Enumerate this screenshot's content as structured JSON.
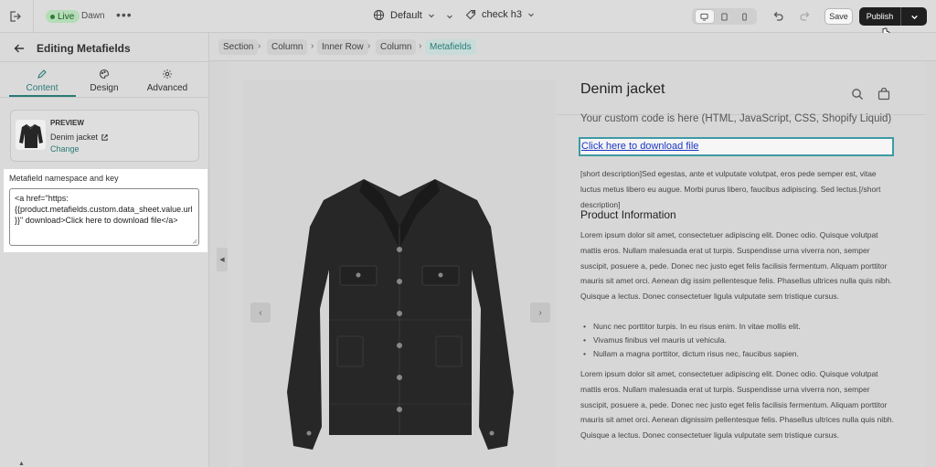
{
  "topbar": {
    "status": "Live",
    "theme": "Dawn",
    "more": "•••",
    "template": "Default",
    "page": "check h3",
    "save_label": "Save",
    "publish_label": "Publish"
  },
  "sidebar": {
    "title": "Editing Metafields",
    "tabs": [
      {
        "label": "Content",
        "active": true
      },
      {
        "label": "Design",
        "active": false
      },
      {
        "label": "Advanced",
        "active": false
      }
    ],
    "preview": {
      "label": "PREVIEW",
      "product": "Denim jacket",
      "change": "Change"
    },
    "metafield": {
      "label": "Metafield namespace and key",
      "value": "<a href=\"https:\n{{product.metafields.custom.data_sheet.value.url}}\" download>Click here to download file</a>"
    }
  },
  "breadcrumbs": [
    "Section",
    "Column",
    "Inner Row",
    "Column",
    "Metafields"
  ],
  "product": {
    "title": "Denim jacket",
    "custom_code": "Your custom code is here (HTML, JavaScript, CSS, Shopify Liquid)",
    "download_link": "Click here to download file",
    "short_description": "[short description]Sed egestas, ante et vulputate volutpat, eros pede semper est, vitae luctus metus libero eu augue. Morbi purus libero, faucibus adipiscing. Sed lectus.[/short description]",
    "info_heading": "Product Information",
    "para1": "Lorem ipsum dolor sit amet, consectetuer adipiscing elit. Donec odio. Quisque volutpat mattis eros. Nullam malesuada erat ut turpis. Suspendisse urna viverra non, semper suscipit, posuere a, pede. Donec nec justo eget felis facilisis fermentum. Aliquam porttitor mauris sit amet orci. Aenean dig issim pellentesque felis. Phasellus ultrices nulla quis nibh. Quisque a lectus. Donec consectetuer ligula vulputate sem tristique cursus.",
    "bullets": [
      "Nunc nec porttitor turpis. In eu risus enim. In vitae mollis elit.",
      "Vivamus finibus vel mauris ut vehicula.",
      "Nullam a magna porttitor, dictum risus nec, faucibus sapien."
    ],
    "para2": "Lorem ipsum dolor sit amet, consectetuer adipiscing elit. Donec odio. Quisque volutpat mattis eros. Nullam malesuada erat ut turpis. Suspendisse urna viverra non, semper suscipit, posuere a, pede. Donec nec justo eget felis facilisis fermentum. Aliquam porttitor mauris sit amet orci. Aenean dignissim pellentesque felis. Phasellus ultrices nulla quis nibh. Quisque a lectus. Donec consectetuer ligula vulputate sem tristique cursus."
  },
  "icons": {
    "exit": "exit-icon",
    "globe": "globe-icon",
    "tag": "tag-icon",
    "desktop": "desktop-icon",
    "tablet": "tablet-icon",
    "mobile": "mobile-icon",
    "undo": "undo-icon",
    "redo": "redo-icon",
    "search": "search-icon",
    "cart": "cart-icon"
  },
  "colors": {
    "accent": "#2a7a75",
    "publish_bg": "#1f1f1f",
    "link": "#1a35c4",
    "selection_border": "#3d9aa4"
  }
}
